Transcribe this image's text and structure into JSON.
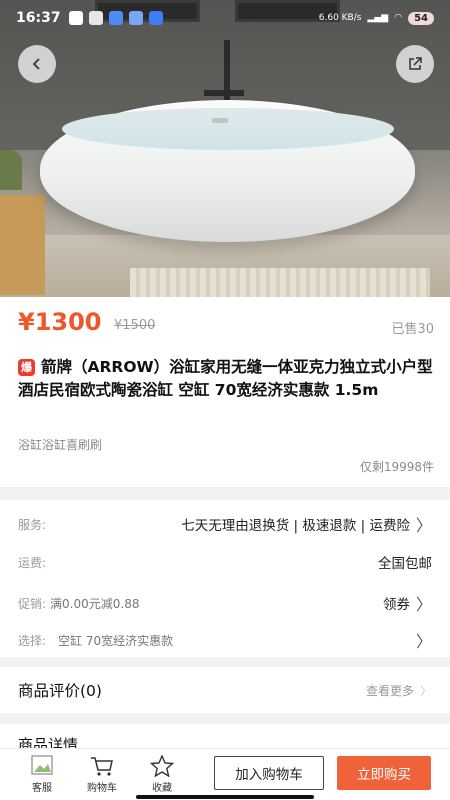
{
  "status_bar": {
    "time": "16:37",
    "network_speed": "6.60 KB/s",
    "battery": "54"
  },
  "product": {
    "price": "¥1300",
    "original_price": "¥1500",
    "sold": "已售30",
    "hot_badge": "爆",
    "title": "箭牌（ARROW）浴缸家用无缝一体亚克力独立式小户型酒店民宿欧式陶瓷浴缸 空缸 70宽经济实惠款 1.5m",
    "shop": "浴缸浴缸喜刷刷",
    "stock": "仅剩19998件"
  },
  "services": {
    "service_label": "服务:",
    "service_value": "七天无理由退换货 | 极速退款 | 运费险",
    "shipping_label": "运费:",
    "shipping_value": "全国包邮",
    "promo_label": "促销:",
    "promo_text": "满0.00元减0.88",
    "promo_link": "领券",
    "select_label": "选择:",
    "select_value": "空缸 70宽经济实惠款"
  },
  "reviews": {
    "title": "商品评价(0)",
    "more": "查看更多"
  },
  "detail": {
    "title": "商品详情"
  },
  "bottom_bar": {
    "service": "客服",
    "cart": "购物车",
    "favorite": "收藏",
    "add_to_cart": "加入购物车",
    "buy_now": "立即购买"
  },
  "colors": {
    "accent": "#f0562a",
    "buy_button": "#f0623a"
  }
}
